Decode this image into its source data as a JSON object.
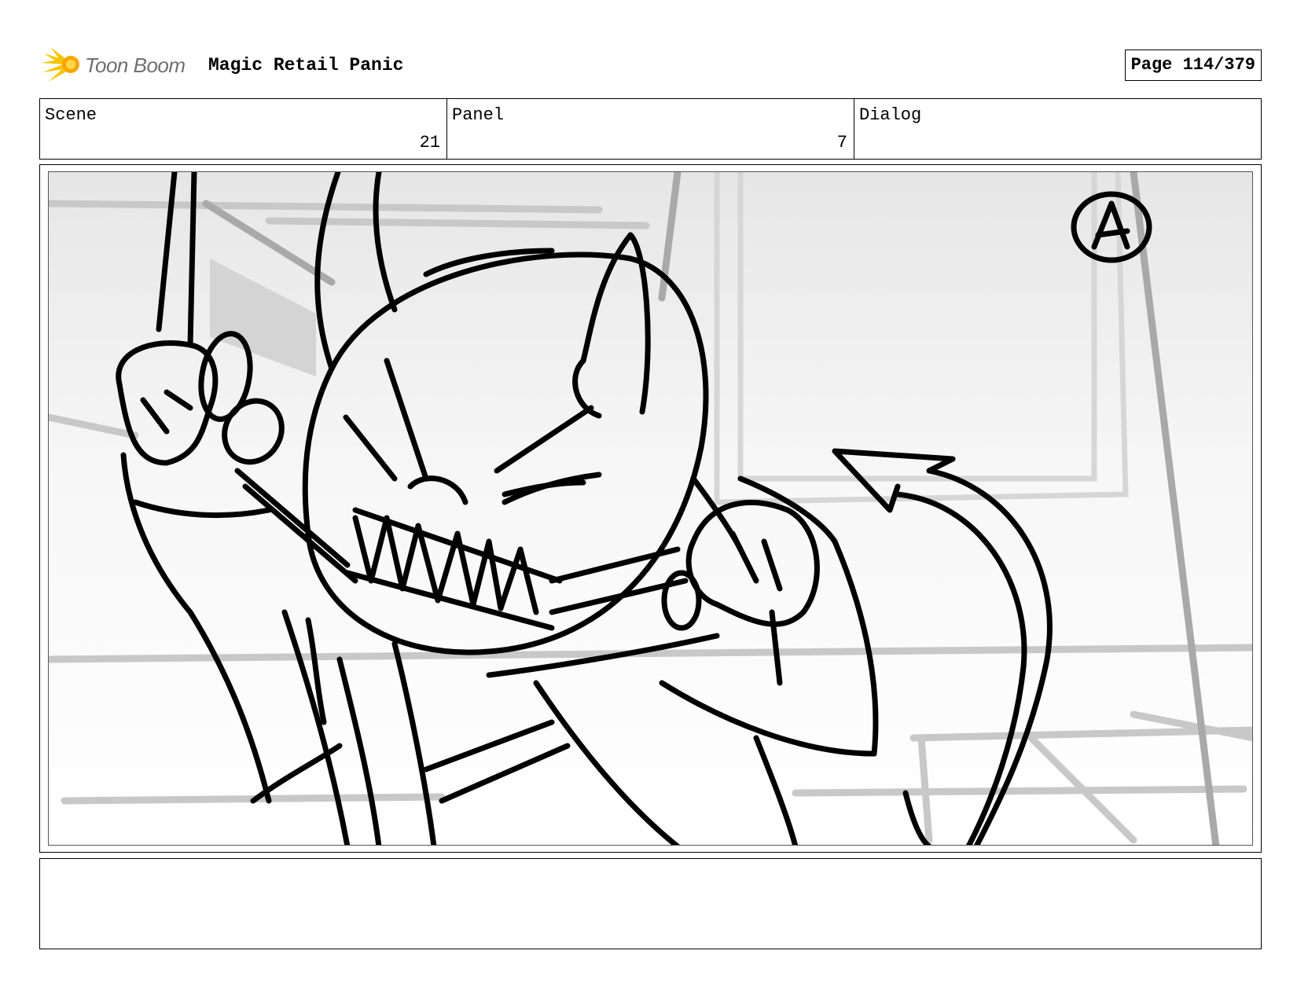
{
  "header": {
    "logo_text": "Toon Boom",
    "project_title": "Magic Retail Panic",
    "page_label": "Page 114/379"
  },
  "info": {
    "scene_label": "Scene",
    "scene_value": "21",
    "panel_label": "Panel",
    "panel_value": "7",
    "dialog_label": "Dialog",
    "dialog_value": ""
  },
  "panel": {
    "corner_mark": "A"
  },
  "notes": {
    "text": ""
  },
  "colors": {
    "logo_accent": "#f5c400",
    "logo_text": "#6f6f6f",
    "border": "#000000"
  },
  "icons": {
    "logo": "toon-boom-star-icon"
  }
}
